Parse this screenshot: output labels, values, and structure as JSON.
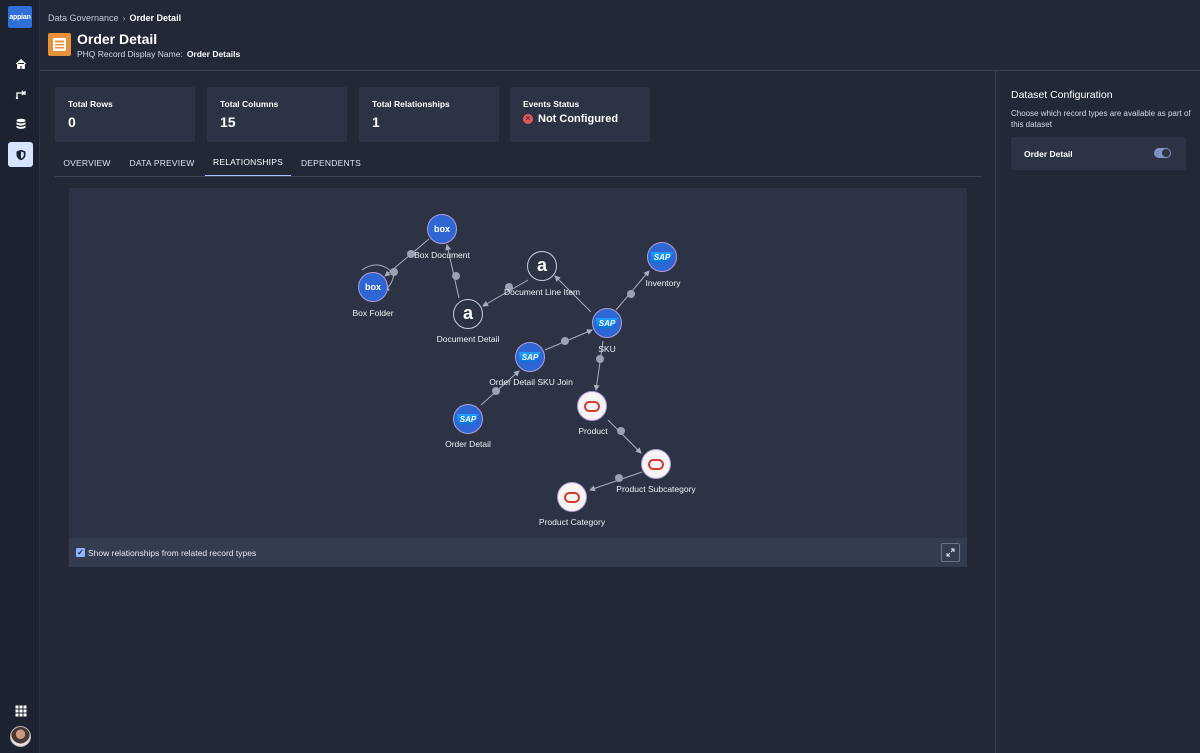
{
  "app": {
    "logo_text": "appian"
  },
  "rail": {
    "items": [
      {
        "icon": "home-icon"
      },
      {
        "icon": "process-icon"
      },
      {
        "icon": "database-icon"
      },
      {
        "icon": "shield-icon",
        "active": true
      }
    ],
    "bottom": [
      {
        "icon": "apps-grid-icon"
      },
      {
        "icon": "avatar"
      }
    ]
  },
  "breadcrumb": {
    "parent": "Data Governance",
    "separator": "›",
    "current": "Order Detail"
  },
  "header": {
    "title": "Order Detail",
    "subtitle_label": "PHQ Record Display Name:",
    "subtitle_value": "Order Details"
  },
  "stats": [
    {
      "label": "Total Rows",
      "value": "0"
    },
    {
      "label": "Total Columns",
      "value": "15"
    },
    {
      "label": "Total Relationships",
      "value": "1"
    },
    {
      "label": "Events Status",
      "value": "Not Configured",
      "status_color": "#e85a5a"
    }
  ],
  "tabs": [
    {
      "label": "OVERVIEW"
    },
    {
      "label": "DATA PREVIEW"
    },
    {
      "label": "RELATIONSHIPS",
      "active": true
    },
    {
      "label": "DEPENDENTS"
    }
  ],
  "graph": {
    "nodes": [
      {
        "id": "box-document",
        "label": "Box Document",
        "source": "box"
      },
      {
        "id": "box-folder",
        "label": "Box Folder",
        "source": "box"
      },
      {
        "id": "document-line-item",
        "label": "Document Line Item",
        "source": "appian"
      },
      {
        "id": "document-detail",
        "label": "Document Detail",
        "source": "appian"
      },
      {
        "id": "inventory",
        "label": "Inventory",
        "source": "sap"
      },
      {
        "id": "sku",
        "label": "SKU",
        "source": "sap"
      },
      {
        "id": "order-detail-sku-join",
        "label": "Order Detail SKU Join",
        "source": "sap"
      },
      {
        "id": "order-detail",
        "label": "Order Detail",
        "source": "sap"
      },
      {
        "id": "product",
        "label": "Product",
        "source": "oracle"
      },
      {
        "id": "product-subcategory",
        "label": "Product Subcategory",
        "source": "oracle"
      },
      {
        "id": "product-category",
        "label": "Product Category",
        "source": "oracle"
      }
    ],
    "glyphs": {
      "box": "box",
      "sap": "SAP",
      "appian": "a"
    },
    "show_related_label": "Show relationships from related record types",
    "show_related_checked": true
  },
  "right_panel": {
    "title": "Dataset Configuration",
    "description": "Choose which record types are available as part of this dataset",
    "rows": [
      {
        "label": "Order Detail",
        "enabled": true
      }
    ]
  }
}
